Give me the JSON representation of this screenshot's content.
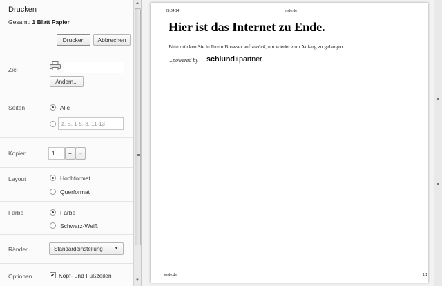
{
  "dialog": {
    "title": "Drucken",
    "summary_prefix": "Gesamt:",
    "summary_value": "1 Blatt Papier",
    "print_label": "Drucken",
    "cancel_label": "Abbrechen"
  },
  "settings": {
    "destination": {
      "label": "Ziel",
      "change_label": "Ändern..."
    },
    "pages": {
      "label": "Seiten",
      "all_label": "Alle",
      "range_placeholder": "z. B. 1-5, 8, 11-13"
    },
    "copies": {
      "label": "Kopien",
      "value": "1",
      "plus": "+",
      "minus": "–"
    },
    "layout": {
      "label": "Layout",
      "portrait": "Hochformat",
      "landscape": "Querformat"
    },
    "color": {
      "label": "Farbe",
      "color_opt": "Farbe",
      "bw_opt": "Schwarz-Weiß"
    },
    "margins": {
      "label": "Ränder",
      "value": "Standardeinstellung"
    },
    "options": {
      "label": "Optionen",
      "headers_footers": "Kopf- und Fußzeilen"
    }
  },
  "preview": {
    "header_date": "28.04.14",
    "header_site": "ende.de",
    "heading": "Hier ist das Internet zu Ende.",
    "text_before": "Bitte drücken Sie in Ihrem Browser auf ",
    "text_em": "zurück",
    "text_after": ", um wieder zum Anfang zu gelangen.",
    "powered": "...powered by",
    "logo_bold": "schlund",
    "logo_sep": "+",
    "logo_rest": "partner",
    "footer_site": "ende.de",
    "footer_page": "1/1"
  }
}
